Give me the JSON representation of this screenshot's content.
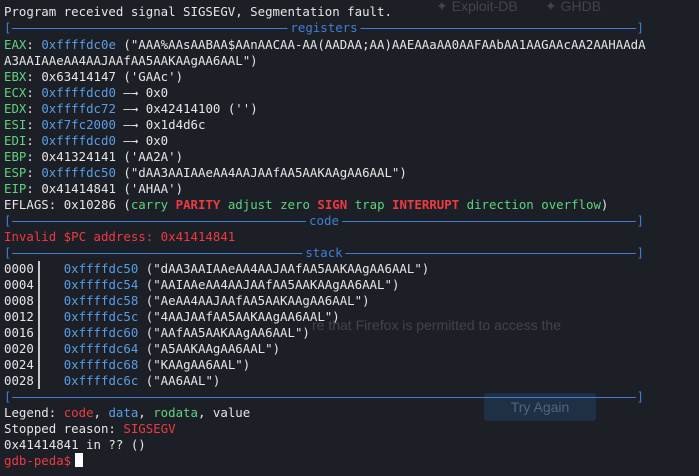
{
  "background_ghost": {
    "tab_left": "Exploit-DB",
    "tab_right": "GHDB",
    "faint_notice": "re that Firefox is permitted to access the",
    "faint_button": "Try Again"
  },
  "header_message": "Program received signal SIGSEGV, Segmentation fault.",
  "sections": {
    "registers": "registers",
    "code": "code",
    "stack": "stack"
  },
  "registers": {
    "eax": {
      "label": "EAX",
      "addr": "0xffffdc0e",
      "value": " (\"AAA%AAsAABAA$AAnAACAA-AA(AADAA;AA)AAEAAaAA0AAFAAbAA1AAGAAcAA2AAHAAdA",
      "cont": "A3AAIAAeAA4AAJAAfAA5AAKAAgAA6AAL\")"
    },
    "ebx": {
      "label": "EBX",
      "value": "0x63414147 ('GAAc')"
    },
    "ecx": {
      "label": "ECX",
      "addr": "0xffffdcd0",
      "arrow": " —→ ",
      "target": "0x0"
    },
    "edx": {
      "label": "EDX",
      "addr": "0xffffdc72",
      "arrow": " —→ ",
      "target": "0x42414100 ('')"
    },
    "esi": {
      "label": "ESI",
      "addr": "0xf7fc2000",
      "arrow": " —→ ",
      "target": "0x1d4d6c"
    },
    "edi": {
      "label": "EDI",
      "addr": "0xffffdcd0",
      "arrow": " —→ ",
      "target": "0x0"
    },
    "ebp": {
      "label": "EBP",
      "value": "0x41324141 ('AA2A')"
    },
    "esp": {
      "label": "ESP",
      "addr": "0xffffdc50",
      "value": " (\"dAA3AAIAAeAA4AAJAAfAA5AAKAAgAA6AAL\")"
    },
    "eip": {
      "label": "EIP",
      "value": "0x41414841 ('AHAA')"
    },
    "eflags": {
      "label": "EFLAGS",
      "value": "0x10286",
      "open": " (",
      "carry": "carry",
      "parity": "PARITY",
      "adjust": "adjust",
      "zero": "zero",
      "sign": "SIGN",
      "trap": "trap",
      "interrupt": "INTERRUPT",
      "direction": "direction",
      "overflow": "overflow",
      "close": ")"
    }
  },
  "code_line": "Invalid $PC address: 0x41414841",
  "stack": [
    {
      "offset": "0000",
      "addr": "0xffffdc50",
      "value": "(\"dAA3AAIAAeAA4AAJAAfAA5AAKAAgAA6AAL\")"
    },
    {
      "offset": "0004",
      "addr": "0xffffdc54",
      "value": "(\"AAIAAeAA4AAJAAfAA5AAKAAgAA6AAL\")"
    },
    {
      "offset": "0008",
      "addr": "0xffffdc58",
      "value": "(\"AeAA4AAJAAfAA5AAKAAgAA6AAL\")"
    },
    {
      "offset": "0012",
      "addr": "0xffffdc5c",
      "value": "(\"4AAJAAfAA5AAKAAgAA6AAL\")"
    },
    {
      "offset": "0016",
      "addr": "0xffffdc60",
      "value": "(\"AAfAA5AAKAAgAA6AAL\")"
    },
    {
      "offset": "0020",
      "addr": "0xffffdc64",
      "value": "(\"A5AAKAAgAA6AAL\")"
    },
    {
      "offset": "0024",
      "addr": "0xffffdc68",
      "value": "(\"KAAgAA6AAL\")"
    },
    {
      "offset": "0028",
      "addr": "0xffffdc6c",
      "value": "(\"AA6AAL\")"
    }
  ],
  "legend": {
    "label": "Legend: ",
    "code": "code",
    "data": "data",
    "rodata": "rodata",
    "value": "value",
    "sep": ", "
  },
  "stopped": {
    "label": "Stopped reason: ",
    "value": "SIGSEGV"
  },
  "frame_line": "0x41414841 in ?? ()",
  "prompt": "gdb-peda$",
  "colors": {
    "background": "#1c1f26",
    "address_blue": "#5b9de3",
    "separator_blue": "#3d7fd6",
    "alert_red": "#ee3a43",
    "flag_green": "#5fd37f",
    "text": "#e6e6e6"
  }
}
